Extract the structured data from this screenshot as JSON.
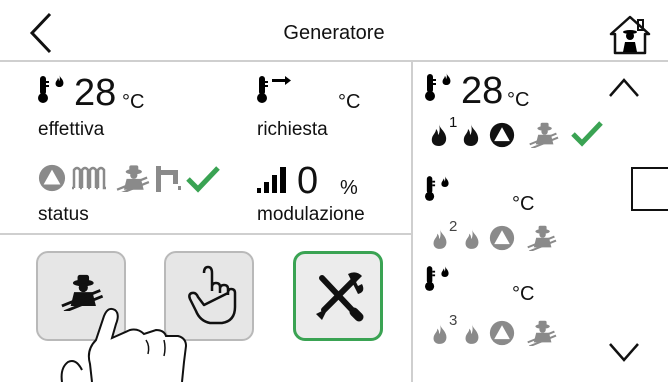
{
  "header": {
    "title": "Generatore",
    "icons": [
      "back-arrow-icon",
      "home-icon"
    ]
  },
  "main": {
    "temp_actual": {
      "value": "28",
      "unit": "°C",
      "label": "effettiva"
    },
    "temp_requested": {
      "value": "",
      "unit": "°C",
      "label": "richiesta"
    },
    "status": {
      "label": "status",
      "icons": [
        "pump-icon",
        "radiator-icon",
        "chimney-sweep-icon",
        "tap-icon",
        "check-icon"
      ]
    },
    "modulation": {
      "value": "0",
      "unit": "%",
      "label": "modulazione"
    }
  },
  "buttons": [
    "chimney-sweep-button",
    "manual-button",
    "tools-button"
  ],
  "right_panel": {
    "gen1": {
      "value": "28",
      "unit": "°C",
      "index": "1"
    },
    "gen2": {
      "value": "",
      "unit": "°C",
      "index": "2"
    },
    "gen3": {
      "value": "",
      "unit": "°C",
      "index": "3"
    }
  },
  "colors": {
    "accent": "#3aa353",
    "icon_gray": "#8a8a8a",
    "divider": "#cfcfcf"
  }
}
